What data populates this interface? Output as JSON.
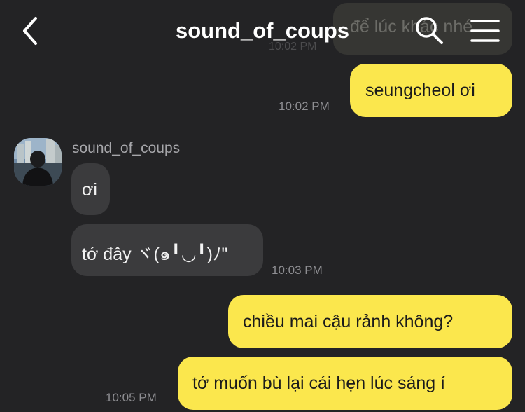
{
  "header": {
    "title": "sound_of_coups",
    "back_icon": "chevron-left-icon",
    "search_icon": "search-icon",
    "menu_icon": "hamburger-menu-icon"
  },
  "peek": {
    "text": "để lúc khác nhé",
    "time": "10:02 PM"
  },
  "messages": {
    "m1": {
      "text": "seungcheol ơi",
      "time": "10:02 PM"
    },
    "sender": "sound_of_coups",
    "m2": {
      "text": "ơi"
    },
    "m3": {
      "text": "tớ đây ヾ(๑╹◡╹)ﾉ\"",
      "time": "10:03 PM"
    },
    "m4": {
      "text": "chiều mai cậu rảnh không?"
    },
    "m5": {
      "text": "tớ muốn bù lại cái hẹn lúc sáng í",
      "time": "10:05 PM"
    }
  },
  "colors": {
    "outgoing": "#fbe74d",
    "incoming": "#3b3b3d",
    "background": "#232325"
  }
}
